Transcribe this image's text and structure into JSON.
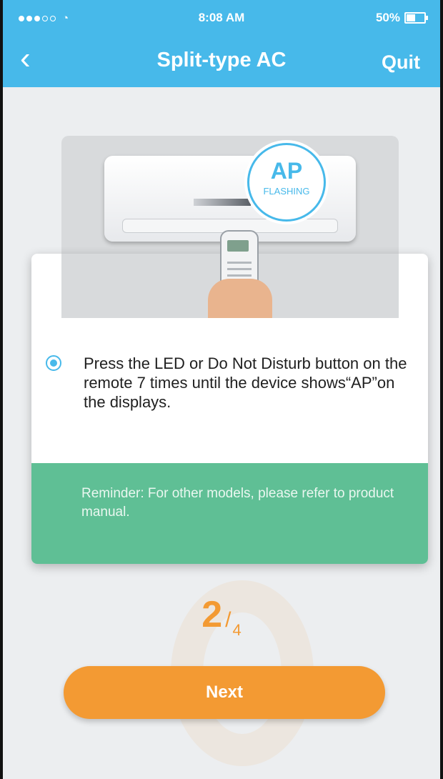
{
  "status_bar": {
    "time": "8:08 AM",
    "battery_text": "50%",
    "battery_level": 0.5,
    "signal_dots_filled": 3,
    "signal_dots_total": 5
  },
  "navbar": {
    "title": "Split-type AC",
    "quit_label": "Quit",
    "back_icon": "chevron-left-icon"
  },
  "illustration": {
    "bubble_title": "AP",
    "bubble_subtitle": "FLASHING",
    "display_text": "AP"
  },
  "instruction": {
    "selected": true,
    "text": "Press the LED or Do Not Disturb button on the remote 7 times until the device shows“AP”on the displays."
  },
  "reminder": {
    "text": "Reminder: For other models, please refer to product manual."
  },
  "step": {
    "current": "2",
    "separator": "/",
    "total": "4"
  },
  "next_button": {
    "label": "Next"
  },
  "colors": {
    "header_blue": "#47b9ea",
    "reminder_green": "#5fbf95",
    "accent_orange": "#f39a33"
  }
}
